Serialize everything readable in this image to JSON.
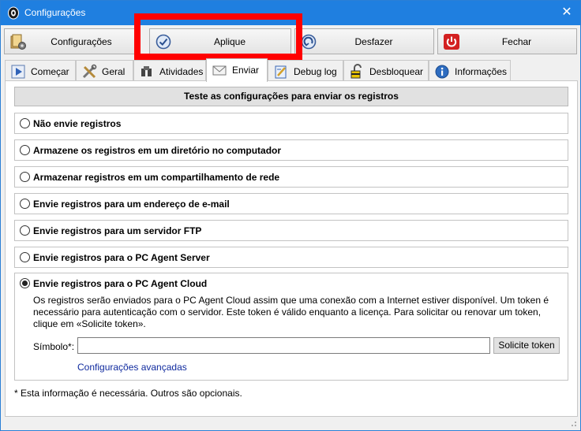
{
  "window": {
    "title": "Configurações",
    "close_symbol": "✕",
    "app_icon": "agent-logo-icon",
    "border_color": "#2a7fd6",
    "titlebar_color": "#1f7fe0"
  },
  "toolbar": {
    "buttons": [
      {
        "label": "Configurações",
        "icon": "settings-folder-icon"
      },
      {
        "label": "Aplique",
        "icon": "apply-check-icon"
      },
      {
        "label": "Desfazer",
        "icon": "undo-icon"
      },
      {
        "label": "Fechar",
        "icon": "power-close-icon"
      }
    ],
    "highlight_color": "#ff0000"
  },
  "tabs": [
    {
      "label": "Começar",
      "icon": "play-icon"
    },
    {
      "label": "Geral",
      "icon": "tools-icon"
    },
    {
      "label": "Atividades",
      "icon": "activity-icon"
    },
    {
      "label": "Enviar",
      "icon": "mail-send-icon",
      "active": true
    },
    {
      "label": "Debug log",
      "icon": "debug-log-icon"
    },
    {
      "label": "Desbloquear",
      "icon": "unlock-icon"
    },
    {
      "label": "Informações",
      "icon": "info-icon"
    }
  ],
  "panel": {
    "header": "Teste as configurações para enviar os registros",
    "options": [
      {
        "label": "Não envie registros",
        "checked": false
      },
      {
        "label": "Armazene os registros em um diretório no computador",
        "checked": false
      },
      {
        "label": "Armazenar registros em um compartilhamento de rede",
        "checked": false
      },
      {
        "label": "Envie registros para um endereço de e-mail",
        "checked": false
      },
      {
        "label": "Envie registros para um servidor FTP",
        "checked": false
      },
      {
        "label": "Envie registros para o PC Agent Server",
        "checked": false
      }
    ],
    "cloud": {
      "label": "Envie registros para o PC Agent Cloud",
      "checked": true,
      "description": "Os registros serão enviados para o PC Agent Cloud assim que uma conexão com a Internet estiver disponível. Um token é necessário para autenticação com o servidor. Este token é válido enquanto a licença. Para solicitar ou renovar um token, clique em «Solicite token».",
      "symbol_label": "Símbolo*:",
      "symbol_value": "",
      "token_button": "Solicite token",
      "advanced_link": "Configurações avançadas",
      "link_color": "#0f2a9e"
    },
    "footnote": "* Esta informação é necessária. Outros são opcionais."
  }
}
